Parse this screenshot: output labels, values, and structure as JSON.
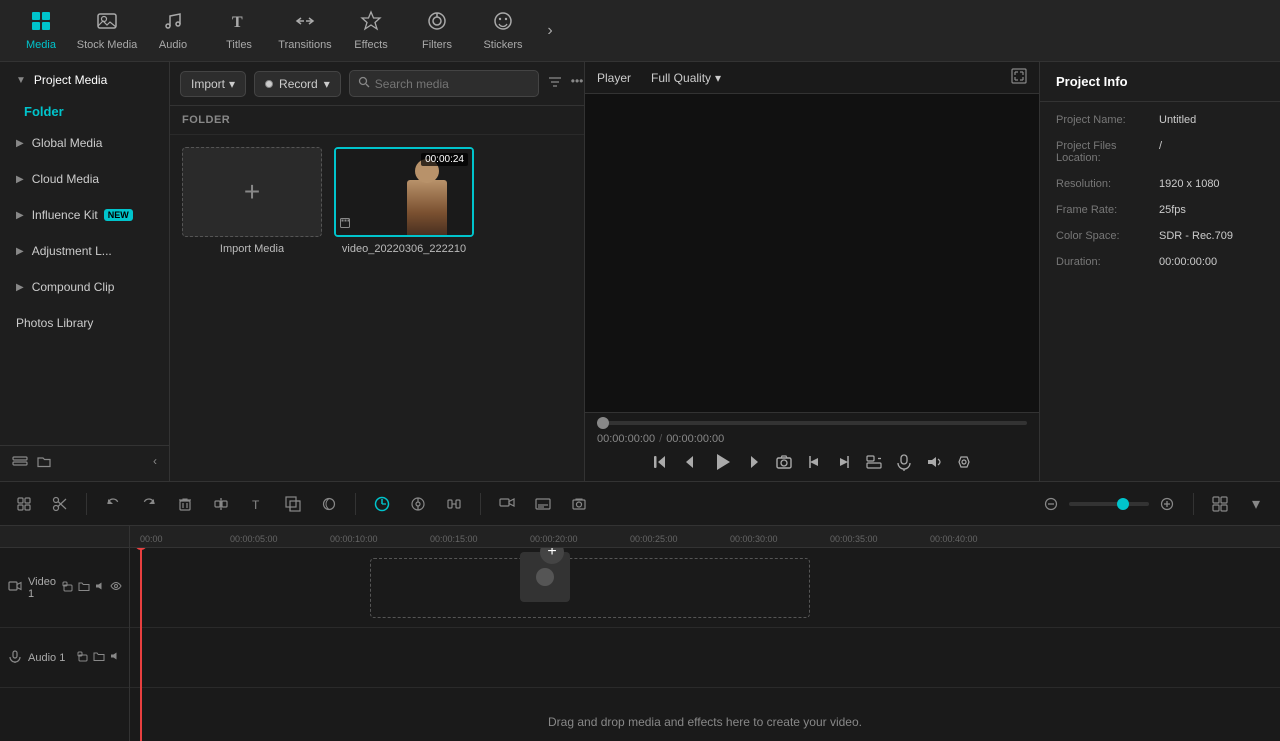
{
  "topNav": {
    "items": [
      {
        "id": "media",
        "label": "Media",
        "icon": "⊞",
        "active": true
      },
      {
        "id": "stock",
        "label": "Stock Media",
        "icon": "▶",
        "active": false
      },
      {
        "id": "audio",
        "label": "Audio",
        "icon": "♪",
        "active": false
      },
      {
        "id": "titles",
        "label": "Titles",
        "icon": "T",
        "active": false
      },
      {
        "id": "transitions",
        "label": "Transitions",
        "icon": "⇄",
        "active": false
      },
      {
        "id": "effects",
        "label": "Effects",
        "icon": "✦",
        "active": false
      },
      {
        "id": "filters",
        "label": "Filters",
        "icon": "⊕",
        "active": false
      },
      {
        "id": "stickers",
        "label": "Stickers",
        "icon": "☺",
        "active": false
      }
    ],
    "moreIcon": "›"
  },
  "sidebar": {
    "sections": [
      {
        "id": "project-media",
        "label": "Project Media",
        "active": true
      },
      {
        "id": "folder",
        "label": "Folder",
        "isFolder": true
      },
      {
        "id": "global-media",
        "label": "Global Media"
      },
      {
        "id": "cloud-media",
        "label": "Cloud Media"
      },
      {
        "id": "influence-kit",
        "label": "Influence Kit",
        "badge": "NEW"
      },
      {
        "id": "adjustment-l",
        "label": "Adjustment L..."
      },
      {
        "id": "compound-clip",
        "label": "Compound Clip"
      },
      {
        "id": "photos-library",
        "label": "Photos Library"
      }
    ]
  },
  "mediaPanel": {
    "importLabel": "Import",
    "recordLabel": "Record",
    "searchPlaceholder": "Search media",
    "folderLabel": "FOLDER",
    "items": [
      {
        "id": "import",
        "type": "import",
        "label": "Import Media"
      },
      {
        "id": "video1",
        "type": "video",
        "label": "video_20220306_222210",
        "duration": "00:00:24"
      }
    ]
  },
  "player": {
    "tabLabel": "Player",
    "quality": "Full Quality",
    "currentTime": "00:00:00:00",
    "totalTime": "00:00:00:00"
  },
  "projectInfo": {
    "title": "Project Info",
    "fields": [
      {
        "label": "Project Name:",
        "value": "Untitled"
      },
      {
        "label": "Project Files Location:",
        "value": "/"
      },
      {
        "label": "Resolution:",
        "value": "1920 x 1080"
      },
      {
        "label": "Frame Rate:",
        "value": "25fps"
      },
      {
        "label": "Color Space:",
        "value": "SDR - Rec.709"
      },
      {
        "label": "Duration:",
        "value": "00:00:00:00"
      }
    ]
  },
  "timeline": {
    "rulerMarks": [
      {
        "time": "00:00",
        "offset": 10
      },
      {
        "time": "00:00:05:00",
        "offset": 100
      },
      {
        "time": "00:00:10:00",
        "offset": 200
      },
      {
        "time": "00:00:15:00",
        "offset": 300
      },
      {
        "time": "00:00:20:00",
        "offset": 400
      },
      {
        "time": "00:00:25:00",
        "offset": 500
      },
      {
        "time": "00:00:30:00",
        "offset": 600
      },
      {
        "time": "00:00:35:00",
        "offset": 700
      },
      {
        "time": "00:00:40:00",
        "offset": 800
      }
    ],
    "tracks": [
      {
        "id": "video1",
        "type": "video",
        "label": "Video 1"
      },
      {
        "id": "audio1",
        "type": "audio",
        "label": "Audio 1"
      }
    ],
    "dragDropText": "Drag and drop media and effects here to create your video."
  }
}
